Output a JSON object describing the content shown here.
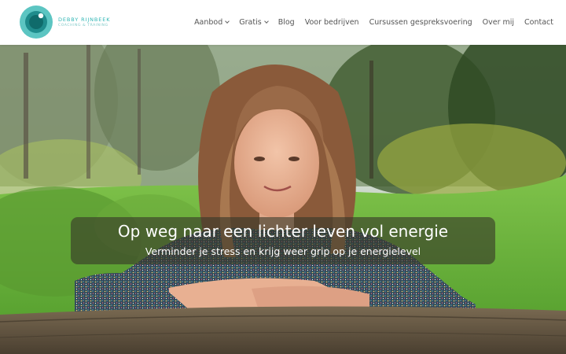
{
  "logo": {
    "name": "DEBBY RIJNBEEK",
    "subtitle": "COACHING & TRAINING",
    "colors": {
      "ring": "#5cc5c2",
      "inner": "#1f8c8c",
      "dark": "#0f6b6b"
    }
  },
  "nav": {
    "items": [
      {
        "label": "Aanbod",
        "has_dropdown": true
      },
      {
        "label": "Gratis",
        "has_dropdown": true
      },
      {
        "label": "Blog",
        "has_dropdown": false
      },
      {
        "label": "Voor bedrijven",
        "has_dropdown": false
      },
      {
        "label": "Cursussen gespreksvoering",
        "has_dropdown": false
      },
      {
        "label": "Over mij",
        "has_dropdown": false
      },
      {
        "label": "Contact",
        "has_dropdown": false
      }
    ]
  },
  "hero": {
    "title": "Op weg naar een lichter leven vol energie",
    "subtitle": "Verminder je stress en krijg weer grip op je energielevel"
  }
}
